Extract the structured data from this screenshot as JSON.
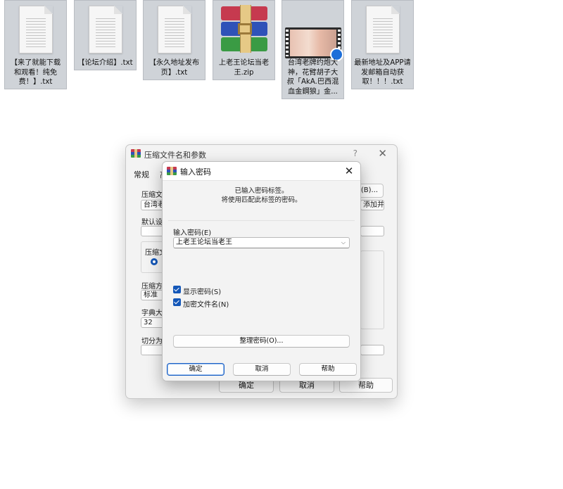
{
  "files": [
    {
      "name": "【来了就能下载和观看！纯免费！】.txt",
      "kind": "txt"
    },
    {
      "name": "【论坛介绍】.txt",
      "kind": "txt"
    },
    {
      "name": "【永久地址发布页】.txt",
      "kind": "txt"
    },
    {
      "name": "上老王论坛当老王.zip",
      "kind": "zip"
    },
    {
      "name": "台湾老牌约炮大神，花臂胡子大叔「AkA.巴西混血金鋼狼」金...",
      "kind": "video"
    },
    {
      "name": "最新地址及APP请发邮箱自动获取！！！.txt",
      "kind": "txt"
    }
  ],
  "back_window": {
    "title": "压缩文件名和参数",
    "help_glyph": "?",
    "close_glyph": "✕",
    "tab_general": "常规",
    "tab_second": "高",
    "archive_name_label": "压缩文件",
    "archive_name_value": "台湾老",
    "browse_button": "(B)...",
    "update_mode_value": "添加并替换文件",
    "default_profile_label": "默认设置",
    "format_group_label": "压缩文",
    "method_label": "压缩方式",
    "method_value": "标准",
    "dict_label": "字典大小",
    "dict_value": "32",
    "split_label": "切分为分卷",
    "ok_button": "确定",
    "cancel_button": "取消",
    "help_button": "帮助"
  },
  "dialog": {
    "title": "输入密码",
    "close_glyph": "✕",
    "message_line1": "已输入密码标签。",
    "message_line2": "将使用匹配此标签的密码。",
    "password_label": "输入密码(E)",
    "password_value": "上老王论坛当老王",
    "show_password_label": "显示密码(S)",
    "show_password_checked": true,
    "encrypt_names_label": "加密文件名(N)",
    "encrypt_names_checked": true,
    "organize_button": "整理密码(O)...",
    "ok_button": "确定",
    "cancel_button": "取消",
    "help_button": "帮助"
  },
  "colors": {
    "accent": "#1457b8",
    "tile_bg": "#cfd3d8"
  }
}
